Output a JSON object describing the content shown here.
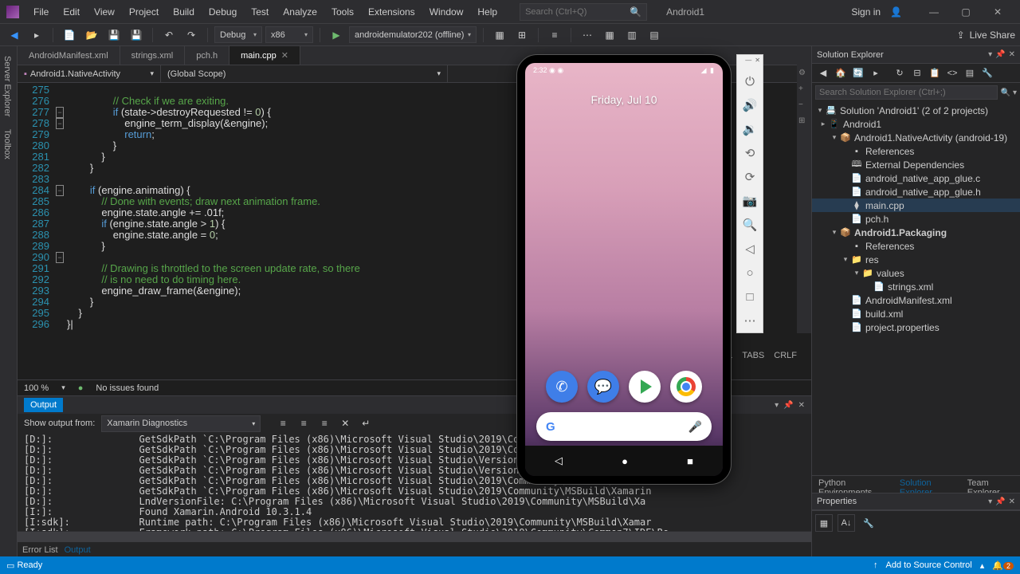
{
  "title_app": "Android1",
  "menu": [
    "File",
    "Edit",
    "View",
    "Project",
    "Build",
    "Debug",
    "Test",
    "Analyze",
    "Tools",
    "Extensions",
    "Window",
    "Help"
  ],
  "search_placeholder": "Search (Ctrl+Q)",
  "signin": "Sign in",
  "live_share": "Live Share",
  "toolbar": {
    "config": "Debug",
    "platform": "x86",
    "target": "androidemulator202 (offline)"
  },
  "left_tabs": [
    "Server Explorer",
    "Toolbox"
  ],
  "file_tabs": [
    {
      "name": "AndroidManifest.xml",
      "active": false
    },
    {
      "name": "strings.xml",
      "active": false
    },
    {
      "name": "pch.h",
      "active": false
    },
    {
      "name": "main.cpp",
      "active": true
    }
  ],
  "nav": {
    "scope1": "Android1.NativeActivity",
    "scope2": "(Global Scope)"
  },
  "line_start": 275,
  "line_end": 296,
  "code": [
    "",
    "                // Check if we are exiting.",
    "                if (state->destroyRequested != 0) {",
    "                    engine_term_display(&engine);",
    "                    return;",
    "                }",
    "            }",
    "        }",
    "",
    "        if (engine.animating) {",
    "            // Done with events; draw next animation frame.",
    "            engine.state.angle += .01f;",
    "            if (engine.state.angle > 1) {",
    "                engine.state.angle = 0;",
    "            }",
    "",
    "            // Drawing is throttled to the screen update rate, so there",
    "            // is no need to do timing here.",
    "            engine_draw_frame(&engine);",
    "        }",
    "    }",
    "}|"
  ],
  "zoom": "100 %",
  "issues": "No issues found",
  "status_right": {
    "tabs": "TABS",
    "crlf": "CRLF",
    "pos": "1"
  },
  "output": {
    "title": "Output",
    "from_label": "Show output from:",
    "source": "Xamarin Diagnostics",
    "lines": [
      "[D:]:               GetSdkPath `C:\\Program Files (x86)\\Microsoft Visual Studio\\2019\\Community\\MSBuild\\Version",
      "[D:]:               GetSdkPath `C:\\Program Files (x86)\\Microsoft Visual Studio\\2019\\Community\\MSBuild\\Version",
      "[D:]:               GetSdkPath `C:\\Program Files (x86)\\Microsoft Visual Studio\\Version.txt` exists=False",
      "[D:]:               GetSdkPath `C:\\Program Files (x86)\\Microsoft Visual Studio\\Version` exists=False",
      "[D:]:               GetSdkPath `C:\\Program Files (x86)\\Microsoft Visual Studio\\2019\\Community\\MSBuild\\Xamarin",
      "[D:]:               GetSdkPath `C:\\Program Files (x86)\\Microsoft Visual Studio\\2019\\Community\\MSBuild\\Xamarin",
      "[D:]:               LndVersionFile: C:\\Program Files (x86)\\Microsoft Visual Studio\\2019\\Community\\MSBuild\\Xa",
      "[I:]:               Found Xamarin.Android 10.3.1.4",
      "[I:sdk]:            Runtime path: C:\\Program Files (x86)\\Microsoft Visual Studio\\2019\\Community\\MSBuild\\Xamar",
      "[I:sdk]:            Framework path: C:\\Program Files (x86)\\Microsoft Visual Studio\\2019\\Community\\Common7\\IDE\\Re                                     android\\v1.0"
    ]
  },
  "bottom_tabs": [
    {
      "name": "Error List",
      "active": false
    },
    {
      "name": "Output",
      "active": true
    }
  ],
  "solution_explorer": {
    "title": "Solution Explorer",
    "search_placeholder": "Search Solution Explorer (Ctrl+;)",
    "solution": "Solution 'Android1' (2 of 2 projects)",
    "tree": [
      {
        "depth": 0,
        "exp": "▸",
        "icon": "📱",
        "label": "Android1"
      },
      {
        "depth": 1,
        "exp": "▾",
        "icon": "📦",
        "label": "Android1.NativeActivity (android-19)"
      },
      {
        "depth": 2,
        "exp": "",
        "icon": "▪",
        "label": "References"
      },
      {
        "depth": 2,
        "exp": "",
        "icon": "🕮",
        "label": "External Dependencies"
      },
      {
        "depth": 2,
        "exp": "",
        "icon": "📄",
        "label": "android_native_app_glue.c"
      },
      {
        "depth": 2,
        "exp": "",
        "icon": "📄",
        "label": "android_native_app_glue.h"
      },
      {
        "depth": 2,
        "exp": "",
        "icon": "⧫",
        "label": "main.cpp",
        "selected": true
      },
      {
        "depth": 2,
        "exp": "",
        "icon": "📄",
        "label": "pch.h"
      },
      {
        "depth": 1,
        "exp": "▾",
        "icon": "📦",
        "label": "Android1.Packaging",
        "bold": true
      },
      {
        "depth": 2,
        "exp": "",
        "icon": "▪",
        "label": "References"
      },
      {
        "depth": 2,
        "exp": "▾",
        "icon": "📁",
        "label": "res"
      },
      {
        "depth": 3,
        "exp": "▾",
        "icon": "📁",
        "label": "values"
      },
      {
        "depth": 4,
        "exp": "",
        "icon": "📄",
        "label": "strings.xml"
      },
      {
        "depth": 2,
        "exp": "",
        "icon": "📄",
        "label": "AndroidManifest.xml"
      },
      {
        "depth": 2,
        "exp": "",
        "icon": "📄",
        "label": "build.xml"
      },
      {
        "depth": 2,
        "exp": "",
        "icon": "📄",
        "label": "project.properties"
      }
    ]
  },
  "panel_tabs": [
    {
      "name": "Python Environments"
    },
    {
      "name": "Solution Explorer",
      "active": true
    },
    {
      "name": "Team Explorer"
    }
  ],
  "properties_title": "Properties",
  "statusbar": {
    "ready": "Ready",
    "source_control": "Add to Source Control",
    "notif_count": "2"
  },
  "emulator": {
    "time": "2:32",
    "date": "Friday, Jul 10"
  }
}
